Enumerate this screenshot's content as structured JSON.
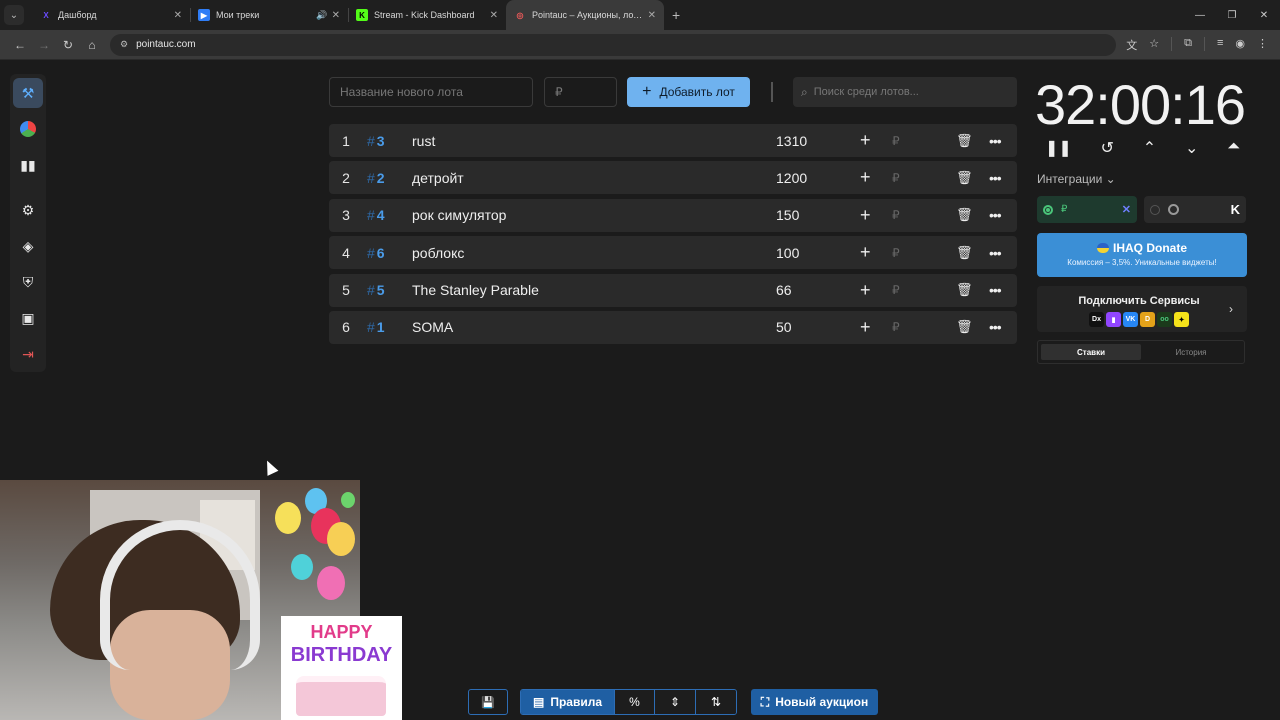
{
  "browser": {
    "tabs": [
      {
        "title": "Дашборд",
        "favicon": "X",
        "fav_color": "#6a4cff"
      },
      {
        "title": "Мои треки",
        "favicon": "▶",
        "fav_color": "#2f7df6"
      },
      {
        "title": "Stream - Kick Dashboard",
        "favicon": "K",
        "fav_color": "#53fc18"
      },
      {
        "title": "Pointauc – Аукционы, лотереи",
        "favicon": "◎",
        "fav_color": "#f05a5a"
      }
    ],
    "url": "pointauc.com"
  },
  "toolbar": {
    "new_lot_placeholder": "Название нового лота",
    "price_placeholder": "₽",
    "add_button": "Добавить лот",
    "search_placeholder": "Поиск среди лотов..."
  },
  "lots": [
    {
      "index": "1",
      "id": "3",
      "name": "rust",
      "amount": "1310"
    },
    {
      "index": "2",
      "id": "2",
      "name": "детройт",
      "amount": "1200"
    },
    {
      "index": "3",
      "id": "4",
      "name": "рок симулятор",
      "amount": "150"
    },
    {
      "index": "4",
      "id": "6",
      "name": "роблокс",
      "amount": "100"
    },
    {
      "index": "5",
      "id": "5",
      "name": "The Stanley Parable",
      "amount": "66"
    },
    {
      "index": "6",
      "id": "1",
      "name": "SOMA",
      "amount": "50"
    }
  ],
  "lot_currency": "₽",
  "timer": "32:00:16",
  "integrations": {
    "label": "Интеграции",
    "donate_title": "IHAQ Donate",
    "donate_subtitle": "Комиссия – 3,5%. Уникальные виджеты!",
    "connect_services": "Подключить Сервисы",
    "currency": "₽"
  },
  "bets_tabs": {
    "bets": "Ставки",
    "history": "История"
  },
  "bottom": {
    "rules": "Правила",
    "percent": "%",
    "new_auction": "Новый аукцион"
  },
  "overlay": {
    "happy": "HAPPY",
    "birthday": "BIRTHDAY"
  },
  "colors": {
    "accent": "#6fb2ef",
    "lot_id": "#4a9be8",
    "primary_dark": "#1f5fa3",
    "background": "#1b1b1b"
  }
}
